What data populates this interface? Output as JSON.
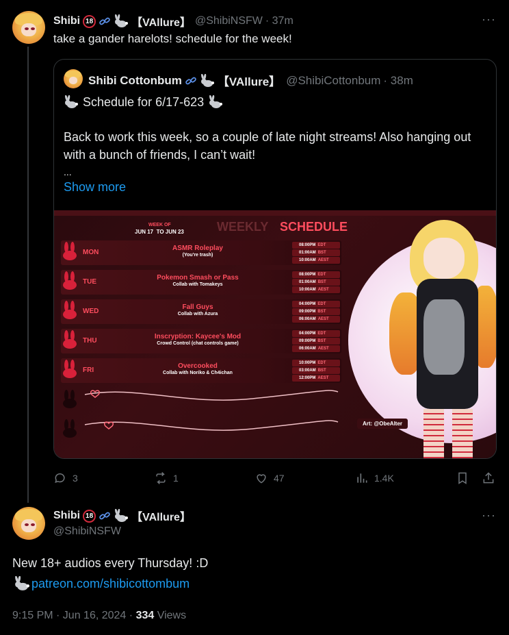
{
  "reply_tweet": {
    "name": "Shibi",
    "badge": "18",
    "tag": "【VAllure】",
    "handle": "@ShibiNSFW",
    "time": "· 37m",
    "text": "take a gander harelots! schedule for the week!"
  },
  "quoted_tweet": {
    "name": "Shibi Cottonbum",
    "tag": "【VAllure】",
    "handle": "@ShibiCottonbum",
    "time": "· 38m",
    "line1": "Schedule for 6/17-623",
    "line2": "Back to work this week, so a couple of late night streams! Also hanging out with a bunch of friends, I can’t wait!",
    "ellipsis": "...",
    "show_more": "Show more"
  },
  "schedule_image": {
    "week_of": "WEEK OF",
    "range": "JUN 17  TO JUN 23",
    "heading_a": "WEEKLY",
    "heading_b": "SCHEDULE",
    "art_credit": "Art: @ObeAlter",
    "days": [
      {
        "day": "MON",
        "title": "ASMR Roleplay",
        "sub": "(You're trash)",
        "t1": "08:00PM",
        "z1": "EDT",
        "t2": "01:00AM",
        "z2": "BST",
        "t3": "10:00AM",
        "z3": "AEST"
      },
      {
        "day": "TUE",
        "title": "Pokemon Smash or Pass",
        "sub": "Collab with Tomakeys",
        "t1": "08:00PM",
        "z1": "EDT",
        "t2": "01:00AM",
        "z2": "BST",
        "t3": "10:00AM",
        "z3": "AEST"
      },
      {
        "day": "WED",
        "title": "Fall Guys",
        "sub": "Collab with Azura",
        "t1": "04:00PM",
        "z1": "EDT",
        "t2": "09:00PM",
        "z2": "BST",
        "t3": "06:00AM",
        "z3": "AEST"
      },
      {
        "day": "THU",
        "title": "Inscryption: Kaycee's Mod",
        "sub": "Crowd Control (chat controls game)",
        "t1": "04:00PM",
        "z1": "EDT",
        "t2": "09:00PM",
        "z2": "BST",
        "t3": "06:00AM",
        "z3": "AEST"
      },
      {
        "day": "FRI",
        "title": "Overcooked",
        "sub": "Collab with Noriko & Ch4ichan",
        "t1": "10:00PM",
        "z1": "EDT",
        "t2": "03:00AM",
        "z2": "BST",
        "t3": "12:00PM",
        "z3": "AEST"
      }
    ]
  },
  "actions": {
    "replies": "3",
    "reposts": "1",
    "likes": "47",
    "views": "1.4K"
  },
  "main_tweet": {
    "name": "Shibi",
    "badge": "18",
    "tag": "【VAllure】",
    "handle": "@ShibiNSFW",
    "text": "New 18+ audios every Thursday! :D",
    "link": "patreon.com/shibicottombum",
    "timestamp": "9:15 PM · Jun 16, 2024 ·",
    "views_count": "334",
    "views_label": "Views"
  },
  "more_label": "···"
}
